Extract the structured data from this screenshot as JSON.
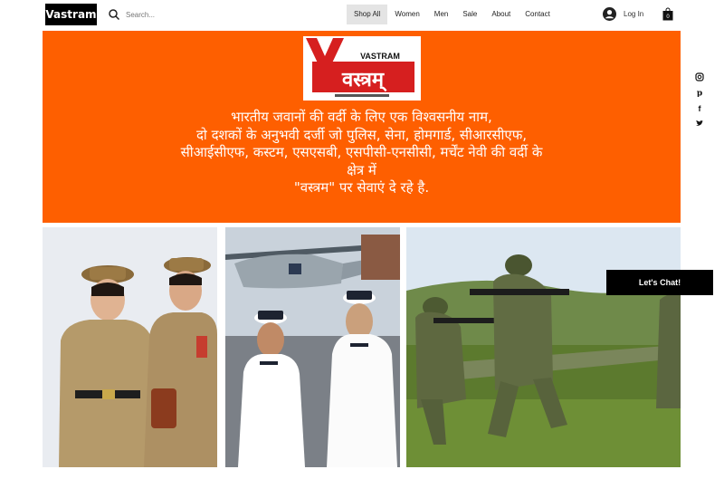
{
  "header": {
    "brand": "Vastram",
    "search_placeholder": "Search...",
    "nav": [
      "Shop All",
      "Women",
      "Men",
      "Sale",
      "About",
      "Contact"
    ],
    "login_label": "Log In",
    "cart_count": "0"
  },
  "banner": {
    "logo_top_text": "VASTRAM",
    "logo_main_text": "वस्त्रम्",
    "tagline": [
      "भारतीय जवानों की वर्दी के लिए एक विश्वसनीय नाम,",
      "दो दशकों के अनुभवी दर्जी जो पुलिस, सेना, होमगार्ड, सीआरसीएफ,",
      "सीआईसीएफ, कस्टम, एसएसबी, एसपीसी-एनसीसी, मर्चेंट नेवी की वर्दी के",
      "क्षेत्र में",
      "\"वस्त्रम\" पर सेवाएं दे रहे है."
    ]
  },
  "social": [
    "instagram-icon",
    "pinterest-icon",
    "facebook-icon",
    "twitter-icon"
  ],
  "photos": [
    "police-uniform-women-photo",
    "navy-uniform-women-photo",
    "army-soldiers-photo"
  ],
  "chat_label": "Let's Chat!"
}
